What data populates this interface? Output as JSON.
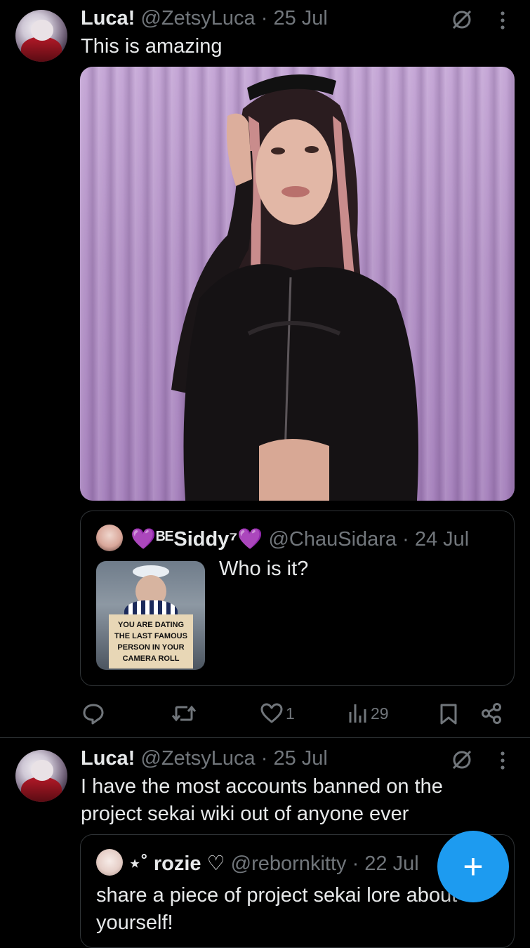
{
  "tweet1": {
    "display_name": "Luca!",
    "handle": "@ZetsyLuca",
    "separator": "·",
    "time": "25 Jul",
    "text": "This is amazing",
    "quote": {
      "display_name": "💜ᴮᴱSiddy⁷💜",
      "handle": "@ChauSidara",
      "separator": "·",
      "time": "24 Jul",
      "text": "Who is it?",
      "image_sign_lines": [
        "YOU ARE DATING",
        "THE LAST FAMOUS",
        "PERSON IN YOUR",
        "CAMERA ROLL"
      ]
    },
    "actions": {
      "reply_count": "",
      "retweet_count": "",
      "like_count": "1",
      "views_count": "29"
    }
  },
  "tweet2": {
    "display_name": "Luca!",
    "handle": "@ZetsyLuca",
    "separator": "·",
    "time": "25 Jul",
    "text_line1": "I have the most accounts banned on the",
    "text_line2": "project sekai wiki out of anyone ever",
    "quote": {
      "display_name": "⋆˚ rozie ♡",
      "handle": "@rebornkitty",
      "separator": "·",
      "time": "22 Jul",
      "text_line1": "share a piece of project sekai lore about",
      "text_line2": "yourself!"
    }
  },
  "fab": {
    "label": "+"
  },
  "colors": {
    "accent": "#1d9bf0",
    "muted": "#71767b",
    "text": "#e7e9ea",
    "background": "#000000"
  },
  "icons": [
    "no-interaction-icon",
    "more-icon",
    "reply-icon",
    "retweet-icon",
    "like-icon",
    "views-icon",
    "bookmark-icon",
    "share-icon",
    "compose-icon"
  ]
}
